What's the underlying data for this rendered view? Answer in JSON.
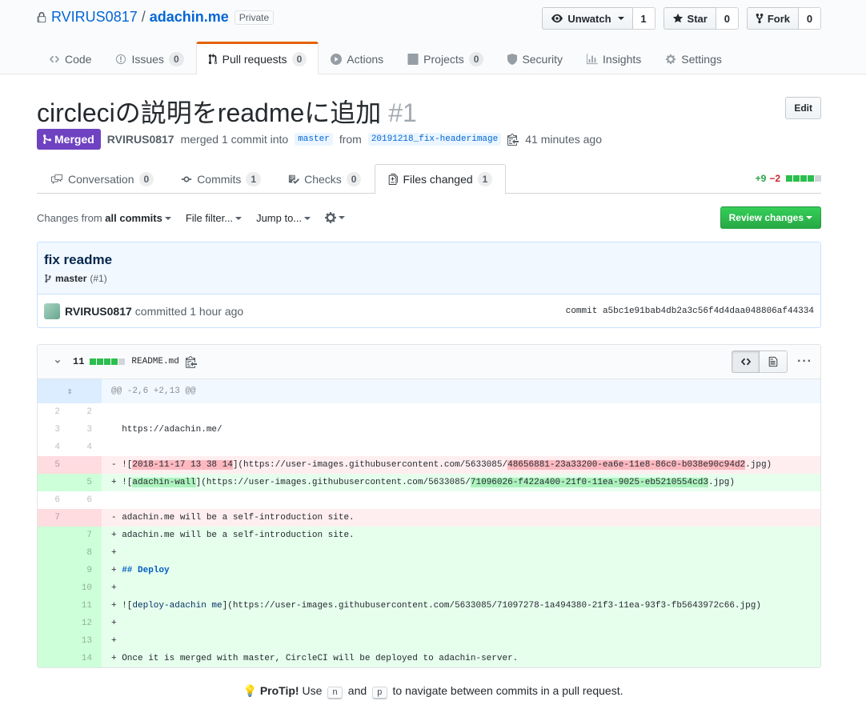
{
  "repo": {
    "owner": "RVIRUS0817",
    "separator": "/",
    "name": "adachin.me",
    "visibility": "Private",
    "unwatch_label": "Unwatch",
    "watch_count": "1",
    "star_label": "Star",
    "star_count": "0",
    "fork_label": "Fork",
    "fork_count": "0"
  },
  "reponav": [
    {
      "label": "Code",
      "count": ""
    },
    {
      "label": "Issues",
      "count": "0"
    },
    {
      "label": "Pull requests",
      "count": "0"
    },
    {
      "label": "Actions",
      "count": ""
    },
    {
      "label": "Projects",
      "count": "0"
    },
    {
      "label": "Security",
      "count": ""
    },
    {
      "label": "Insights",
      "count": ""
    },
    {
      "label": "Settings",
      "count": ""
    }
  ],
  "pr": {
    "title": "circleciの説明をreadmeに追加",
    "number": "#1",
    "edit_label": "Edit",
    "state": "Merged",
    "author": "RVIRUS0817",
    "merged_text": "merged 1 commit into",
    "base_branch": "master",
    "from_text": "from",
    "head_branch": "20191218_fix-headerimage",
    "time": "41 minutes ago"
  },
  "tabs": [
    {
      "label": "Conversation",
      "count": "0"
    },
    {
      "label": "Commits",
      "count": "1"
    },
    {
      "label": "Checks",
      "count": "0"
    },
    {
      "label": "Files changed",
      "count": "1"
    }
  ],
  "diffstat": {
    "additions": "+9",
    "deletions": "−2"
  },
  "toolbar": {
    "changes_from": "Changes from",
    "all_commits": "all commits",
    "file_filter": "File filter...",
    "jump_to": "Jump to...",
    "review_label": "Review changes"
  },
  "commit": {
    "title": "fix readme",
    "branch": "master",
    "pr_ref": "(#1)",
    "author": "RVIRUS0817",
    "committed_text": "committed 1 hour ago",
    "sha": "commit a5bc1e91bab4db2a3c56f4d4daa048806af44334"
  },
  "file": {
    "changes": "11",
    "name": "README.md",
    "hunk": "@@ -2,6 +2,13 @@"
  },
  "diff_lines": [
    {
      "type": "ctx",
      "old": "2",
      "new": "2",
      "parts": [
        {
          "t": "  "
        }
      ]
    },
    {
      "type": "ctx",
      "old": "3",
      "new": "3",
      "parts": [
        {
          "t": "  https://adachin.me/"
        }
      ]
    },
    {
      "type": "ctx",
      "old": "4",
      "new": "4",
      "parts": [
        {
          "t": "  "
        }
      ]
    },
    {
      "type": "del",
      "old": "5",
      "new": "",
      "parts": [
        {
          "t": "- !["
        },
        {
          "t": "2018-11-17 13 38 14",
          "c": "xdel"
        },
        {
          "t": "](https://user-images.githubusercontent.com/5633085/"
        },
        {
          "t": "48656881-23a33200-ea6e-11e8-86c0-b038e90c94d2",
          "c": "xdel"
        },
        {
          "t": ".jpg)"
        }
      ]
    },
    {
      "type": "ins",
      "old": "",
      "new": "5",
      "parts": [
        {
          "t": "+ !["
        },
        {
          "t": "adachin-wall",
          "c": "xins"
        },
        {
          "t": "](https://user-images.githubusercontent.com/5633085/"
        },
        {
          "t": "71096026-f422a400-21f0-11ea-9025-eb5210554cd3",
          "c": "xins"
        },
        {
          "t": ".jpg)"
        }
      ]
    },
    {
      "type": "ctx",
      "old": "6",
      "new": "6",
      "parts": [
        {
          "t": "  "
        }
      ]
    },
    {
      "type": "del",
      "old": "7",
      "new": "",
      "parts": [
        {
          "t": "- adachin.me will be a self-introduction site."
        }
      ]
    },
    {
      "type": "ins",
      "old": "",
      "new": "7",
      "parts": [
        {
          "t": "+ adachin.me will be a self-introduction site."
        }
      ]
    },
    {
      "type": "ins",
      "old": "",
      "new": "8",
      "parts": [
        {
          "t": "+ "
        }
      ]
    },
    {
      "type": "ins",
      "old": "",
      "new": "9",
      "parts": [
        {
          "t": "+ "
        },
        {
          "t": "## Deploy",
          "c": "kw"
        }
      ]
    },
    {
      "type": "ins",
      "old": "",
      "new": "10",
      "parts": [
        {
          "t": "+ "
        }
      ]
    },
    {
      "type": "ins",
      "old": "",
      "new": "11",
      "parts": [
        {
          "t": "+ !["
        },
        {
          "t": "deploy-adachin me",
          "c": "link"
        },
        {
          "t": "](https://user-images.githubusercontent.com/5633085/71097278-1a494380-21f3-11ea-93f3-fb5643972c66.jpg)"
        }
      ]
    },
    {
      "type": "ins",
      "old": "",
      "new": "12",
      "parts": [
        {
          "t": "+ "
        }
      ]
    },
    {
      "type": "ins",
      "old": "",
      "new": "13",
      "parts": [
        {
          "t": "+ "
        }
      ]
    },
    {
      "type": "ins",
      "old": "",
      "new": "14",
      "parts": [
        {
          "t": "+ Once it is merged with master, CircleCI will be deployed to adachin-server."
        }
      ]
    }
  ],
  "protip": {
    "label": "ProTip!",
    "text1": "Use",
    "key1": "n",
    "text2": "and",
    "key2": "p",
    "text3": "to navigate between commits in a pull request."
  },
  "colors": {
    "merged": "#6f42c1",
    "accent_tab": "#e36209",
    "review": "#28a745"
  }
}
